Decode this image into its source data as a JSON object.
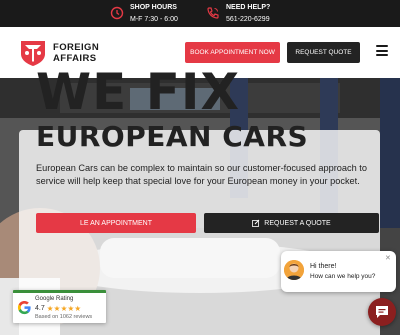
{
  "topbar": {
    "hours_title": "SHOP HOURS",
    "hours_value": "M-F 7:30 - 6:00",
    "help_title": "NEED HELP?",
    "help_value": "561-220-6299"
  },
  "header": {
    "logo_line1": "FOREIGN",
    "logo_line2": "AFFAIRS",
    "book_label": "BOOK APPOINTMENT NOW",
    "quote_label": "REQUEST QUOTE"
  },
  "hero": {
    "headline": "WE FIX",
    "subheadline": "EUROPEAN CARS",
    "paragraph": "European Cars can be complex to maintain so our customer-focused approach to service will help keep that special love for your European money in your pocket.",
    "appointment_label": "LE AN APPOINTMENT",
    "request_quote_label": "REQUEST A QUOTE"
  },
  "google_rating": {
    "title": "Google Rating",
    "score": "4.7",
    "stars": "★★★★★",
    "reviews": "Based on 1062 reviews"
  },
  "chat": {
    "greeting": "Hi there!",
    "message": "How can we help you?"
  },
  "colors": {
    "brand_red": "#e53945",
    "dark": "#232323"
  }
}
